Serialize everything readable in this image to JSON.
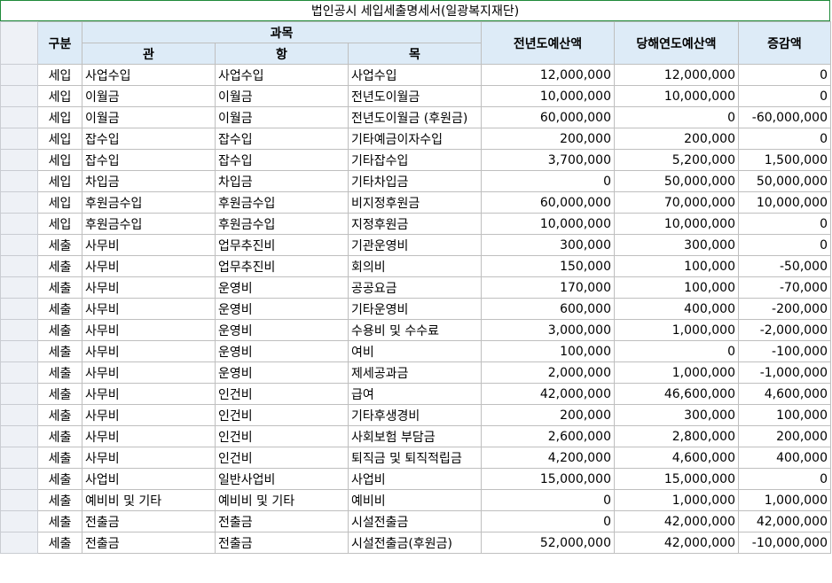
{
  "sheet_title": "법인공시 세입세출명세서(일광복지재단)",
  "headers": {
    "gubun": "구분",
    "gwamok": "과목",
    "gwan": "관",
    "hang": "항",
    "mok": "목",
    "prev_budget": "전년도예산액",
    "curr_budget": "당해연도예산액",
    "diff": "증감액"
  },
  "rows": [
    {
      "gubun": "세입",
      "gwan": "사업수입",
      "hang": "사업수입",
      "mok": "사업수입",
      "prev": "12,000,000",
      "curr": "12,000,000",
      "diff": "0"
    },
    {
      "gubun": "세입",
      "gwan": "이월금",
      "hang": "이월금",
      "mok": "전년도이월금",
      "prev": "10,000,000",
      "curr": "10,000,000",
      "diff": "0"
    },
    {
      "gubun": "세입",
      "gwan": "이월금",
      "hang": "이월금",
      "mok": "전년도이월금 (후원금)",
      "prev": "60,000,000",
      "curr": "0",
      "diff": "-60,000,000"
    },
    {
      "gubun": "세입",
      "gwan": "잡수입",
      "hang": "잡수입",
      "mok": "기타예금이자수입",
      "prev": "200,000",
      "curr": "200,000",
      "diff": "0"
    },
    {
      "gubun": "세입",
      "gwan": "잡수입",
      "hang": "잡수입",
      "mok": "기타잡수입",
      "prev": "3,700,000",
      "curr": "5,200,000",
      "diff": "1,500,000"
    },
    {
      "gubun": "세입",
      "gwan": "차입금",
      "hang": "차입금",
      "mok": "기타차입금",
      "prev": "0",
      "curr": "50,000,000",
      "diff": "50,000,000"
    },
    {
      "gubun": "세입",
      "gwan": "후원금수입",
      "hang": "후원금수입",
      "mok": "비지정후원금",
      "prev": "60,000,000",
      "curr": "70,000,000",
      "diff": "10,000,000"
    },
    {
      "gubun": "세입",
      "gwan": "후원금수입",
      "hang": "후원금수입",
      "mok": "지정후원금",
      "prev": "10,000,000",
      "curr": "10,000,000",
      "diff": "0"
    },
    {
      "gubun": "세출",
      "gwan": "사무비",
      "hang": "업무추진비",
      "mok": "기관운영비",
      "prev": "300,000",
      "curr": "300,000",
      "diff": "0"
    },
    {
      "gubun": "세출",
      "gwan": "사무비",
      "hang": "업무추진비",
      "mok": "회의비",
      "prev": "150,000",
      "curr": "100,000",
      "diff": "-50,000"
    },
    {
      "gubun": "세출",
      "gwan": "사무비",
      "hang": "운영비",
      "mok": "공공요금",
      "prev": "170,000",
      "curr": "100,000",
      "diff": "-70,000"
    },
    {
      "gubun": "세출",
      "gwan": "사무비",
      "hang": "운영비",
      "mok": "기타운영비",
      "prev": "600,000",
      "curr": "400,000",
      "diff": "-200,000"
    },
    {
      "gubun": "세출",
      "gwan": "사무비",
      "hang": "운영비",
      "mok": "수용비 및 수수료",
      "prev": "3,000,000",
      "curr": "1,000,000",
      "diff": "-2,000,000"
    },
    {
      "gubun": "세출",
      "gwan": "사무비",
      "hang": "운영비",
      "mok": "여비",
      "prev": "100,000",
      "curr": "0",
      "diff": "-100,000"
    },
    {
      "gubun": "세출",
      "gwan": "사무비",
      "hang": "운영비",
      "mok": "제세공과금",
      "prev": "2,000,000",
      "curr": "1,000,000",
      "diff": "-1,000,000"
    },
    {
      "gubun": "세출",
      "gwan": "사무비",
      "hang": "인건비",
      "mok": "급여",
      "prev": "42,000,000",
      "curr": "46,600,000",
      "diff": "4,600,000"
    },
    {
      "gubun": "세출",
      "gwan": "사무비",
      "hang": "인건비",
      "mok": "기타후생경비",
      "prev": "200,000",
      "curr": "300,000",
      "diff": "100,000"
    },
    {
      "gubun": "세출",
      "gwan": "사무비",
      "hang": "인건비",
      "mok": "사회보험 부담금",
      "prev": "2,600,000",
      "curr": "2,800,000",
      "diff": "200,000"
    },
    {
      "gubun": "세출",
      "gwan": "사무비",
      "hang": "인건비",
      "mok": "퇴직금 및 퇴직적립금",
      "prev": "4,200,000",
      "curr": "4,600,000",
      "diff": "400,000"
    },
    {
      "gubun": "세출",
      "gwan": "사업비",
      "hang": "일반사업비",
      "mok": "사업비",
      "prev": "15,000,000",
      "curr": "15,000,000",
      "diff": "0"
    },
    {
      "gubun": "세출",
      "gwan": "예비비 및 기타",
      "hang": "예비비 및 기타",
      "mok": "예비비",
      "prev": "0",
      "curr": "1,000,000",
      "diff": "1,000,000"
    },
    {
      "gubun": "세출",
      "gwan": "전출금",
      "hang": "전출금",
      "mok": "시설전출금",
      "prev": "0",
      "curr": "42,000,000",
      "diff": "42,000,000"
    },
    {
      "gubun": "세출",
      "gwan": "전출금",
      "hang": "전출금",
      "mok": "시설전출금(후원금)",
      "prev": "52,000,000",
      "curr": "42,000,000",
      "diff": "-10,000,000"
    }
  ]
}
